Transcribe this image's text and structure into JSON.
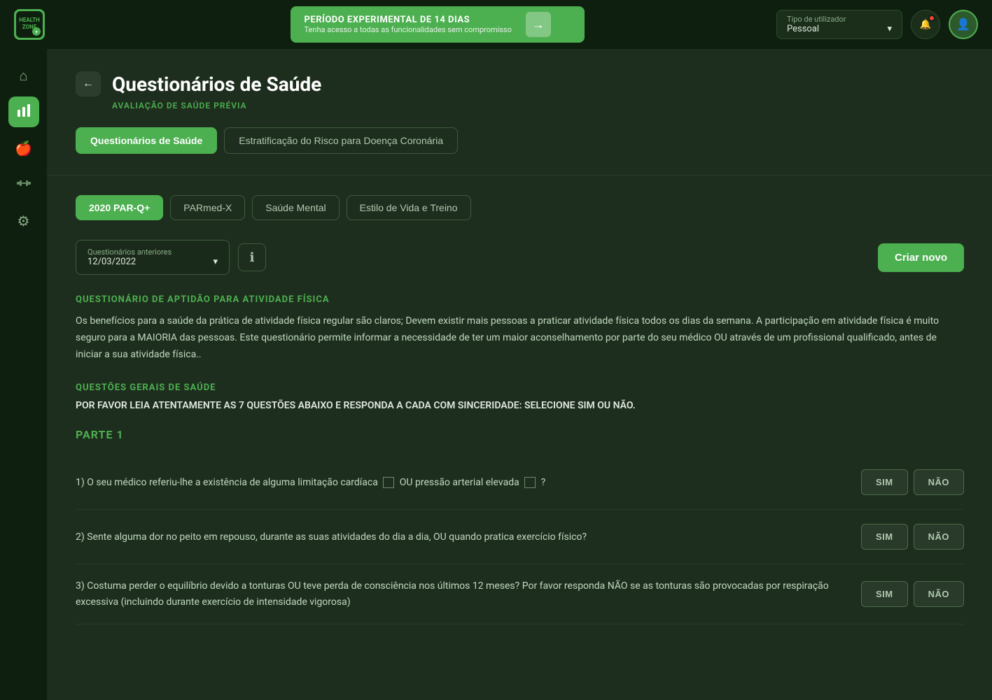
{
  "logo": {
    "text": "HEALTH\nZONE",
    "alt": "HealthZone logo"
  },
  "topnav": {
    "trial_title": "PERÍODO EXPERIMENTAL DE 14 DIAS",
    "trial_sub": "Tenha acesso a todas as funcionalidades sem compromisso",
    "arrow": "→",
    "user_type_label": "Tipo de utilizador",
    "user_type_value": "Pessoal",
    "chevron": "▾"
  },
  "sidebar": {
    "items": [
      {
        "id": "home",
        "icon": "⌂",
        "active": false
      },
      {
        "id": "chart",
        "icon": "📊",
        "active": true
      },
      {
        "id": "apple",
        "icon": "🍎",
        "active": false
      },
      {
        "id": "dumbbell",
        "icon": "🏋",
        "active": false
      },
      {
        "id": "settings",
        "icon": "⚙",
        "active": false
      }
    ]
  },
  "page": {
    "back_btn": "←",
    "title": "Questionários de Saúde",
    "subtitle": "AVALIAÇÃO DE SAÚDE PRÉVIA"
  },
  "tabs": [
    {
      "label": "Questionários de Saúde",
      "active": true
    },
    {
      "label": "Estratificação do Risco para Doença Coronária",
      "active": false
    }
  ],
  "sub_tabs": [
    {
      "label": "2020 PAR-Q+",
      "active": true
    },
    {
      "label": "PARmed-X",
      "active": false
    },
    {
      "label": "Saúde Mental",
      "active": false
    },
    {
      "label": "Estilo de Vida e Treino",
      "active": false
    }
  ],
  "controls": {
    "dropdown_label": "Questionários anteriores",
    "dropdown_value": "12/03/2022",
    "chevron": "▾",
    "info_icon": "ℹ",
    "create_btn": "Criar novo"
  },
  "questionnaire": {
    "section1_title": "QUESTIONÁRIO DE APTIDÃO PARA ATIVIDADE FÍSICA",
    "section1_desc": "Os benefícios para a saúde da prática de atividade física regular são claros; Devem existir mais pessoas a praticar atividade física todos os dias da semana. A participação em atividade física é muito seguro para a MAIORIA das pessoas. Este questionário permite informar a necessidade de ter um maior aconselhamento por parte do seu médico OU através de um profissional qualificado, antes de iniciar a sua atividade física..",
    "section2_title": "QUESTÕES GERAIS DE SAÚDE",
    "instruction": "POR FAVOR LEIA ATENTAMENTE AS 7 QUESTÕES ABAIXO E RESPONDA A CADA COM SINCERIDADE: SELECIONE SIM OU NÃO.",
    "part1_label": "PARTE 1",
    "questions": [
      {
        "id": 1,
        "text_before": "1) O seu médico referiu-lhe a existência de alguma limitação cardíaca",
        "has_checkbox1": true,
        "text_middle": "OU pressão arterial elevada",
        "has_checkbox2": true,
        "text_after": "?",
        "sim": "SIM",
        "nao": "NÃO"
      },
      {
        "id": 2,
        "text": "2) Sente alguma dor no peito em repouso, durante as suas atividades do dia a dia, OU quando pratica exercício físico?",
        "sim": "SIM",
        "nao": "NÃO"
      },
      {
        "id": 3,
        "text": "3) Costuma perder o equilíbrio devido a tonturas OU teve perda de consciência nos últimos 12 meses? Por favor responda NÃO se as tonturas são provocadas por respiração excessiva (incluindo durante exercício de intensidade vigorosa)",
        "sim": "SIM",
        "nao": "NÃO"
      }
    ]
  }
}
